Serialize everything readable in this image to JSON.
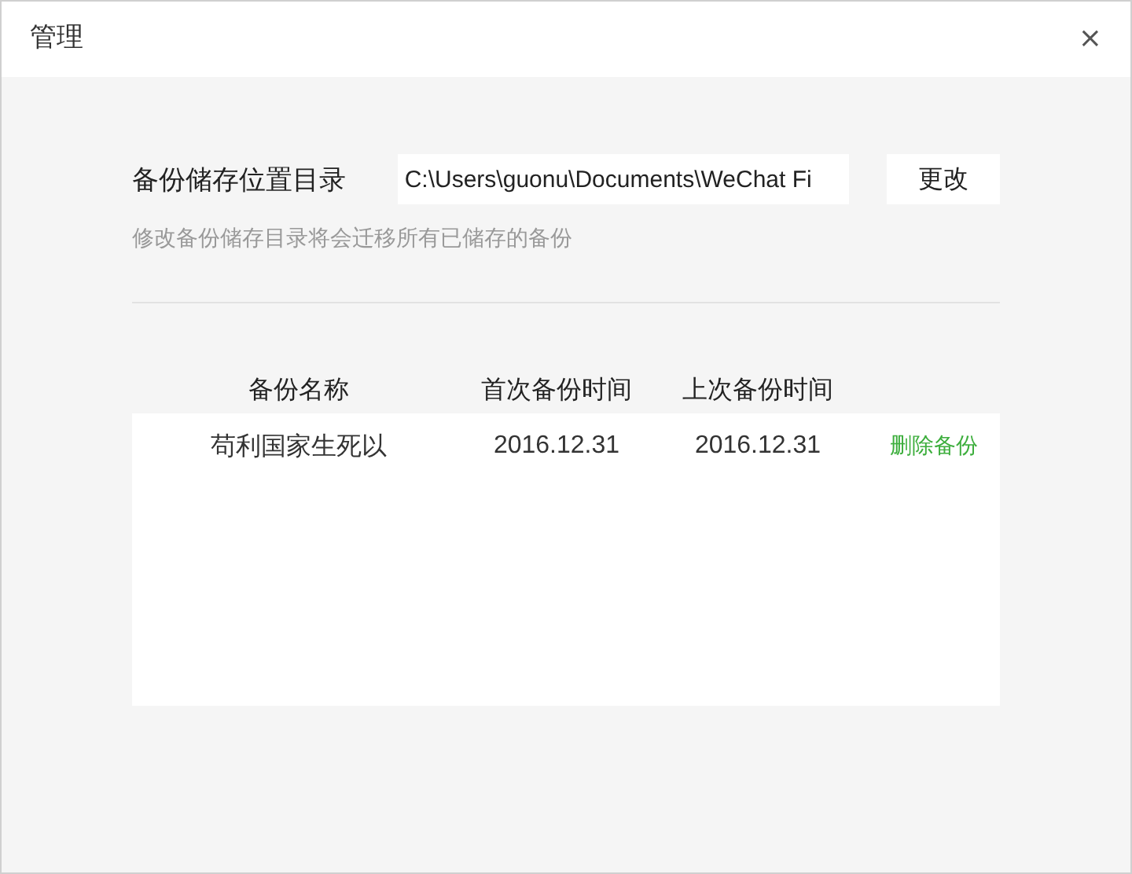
{
  "window": {
    "title": "管理",
    "close": "×"
  },
  "backup_location": {
    "label": "备份储存位置目录",
    "path": "C:\\Users\\guonu\\Documents\\WeChat Fi",
    "button": "更改",
    "hint": "修改备份储存目录将会迁移所有已储存的备份"
  },
  "table": {
    "columns": [
      "备份名称",
      "首次备份时间",
      "上次备份时间"
    ],
    "rows": [
      {
        "name": "苟利国家生死以",
        "first_backup": "2016.12.31",
        "last_backup": "2016.12.31",
        "action": "删除备份"
      }
    ]
  }
}
